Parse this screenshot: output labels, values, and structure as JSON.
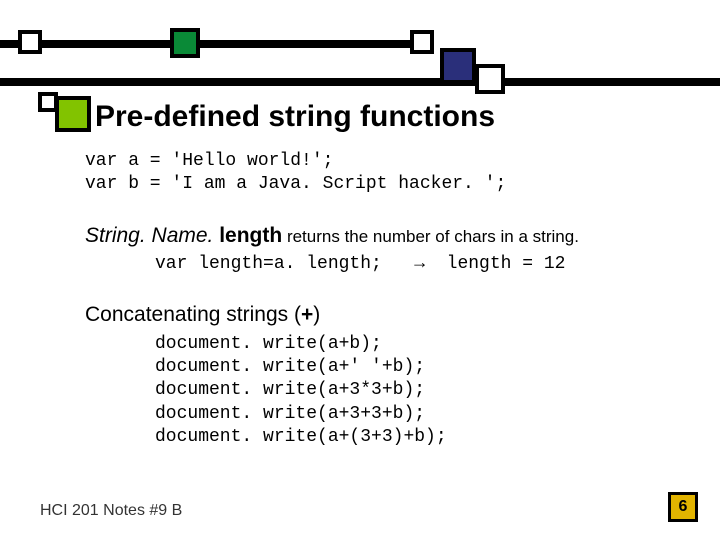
{
  "title": "Pre-defined string functions",
  "code_intro": "var a = 'Hello world!';\nvar b = 'I am a Java. Script hacker. ';",
  "length_section": {
    "prefix_italic": "String. Name. ",
    "keyword": "length",
    "trail": " returns the number of chars in a string.",
    "example": "var length=a. length;   →  length = 12"
  },
  "concat_section": {
    "heading_a": "Concatenating strings (",
    "heading_b": "+",
    "heading_c": ")",
    "lines": "document. write(a+b);\ndocument. write(a+' '+b);\ndocument. write(a+3*3+b);\ndocument. write(a+3+3+b);\ndocument. write(a+(3+3)+b);"
  },
  "footer": "HCI 201 Notes #9 B",
  "page_number": "6"
}
